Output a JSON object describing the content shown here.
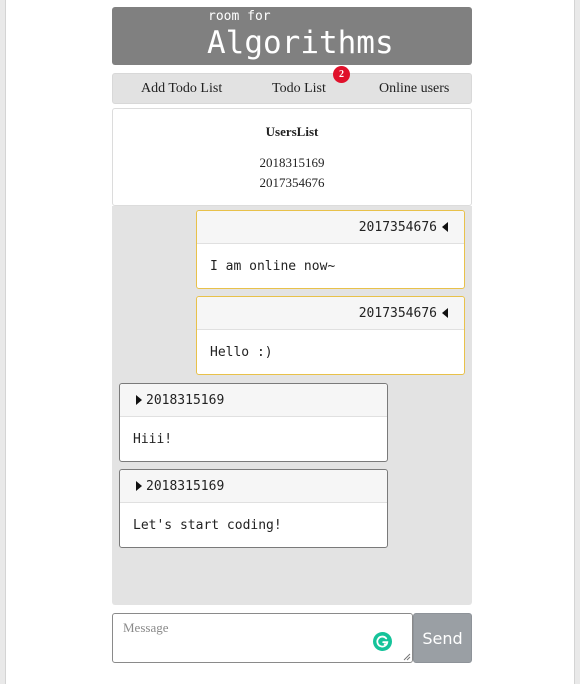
{
  "header": {
    "subtitle": "room for",
    "title": "Algorithms"
  },
  "nav": {
    "items": [
      {
        "label": "Add Todo List"
      },
      {
        "label": "Todo List"
      },
      {
        "label": "Online users"
      }
    ],
    "badge_count": "2"
  },
  "users": {
    "heading": "UsersList",
    "list": [
      "2018315169",
      "2017354676"
    ]
  },
  "messages": [
    {
      "sender": "2017354676",
      "text": "I am online now~",
      "side": "mine"
    },
    {
      "sender": "2017354676",
      "text": "Hello :)",
      "side": "mine"
    },
    {
      "sender": "2018315169",
      "text": "Hiii!",
      "side": "other"
    },
    {
      "sender": "2018315169",
      "text": "Let's start coding!",
      "side": "other"
    }
  ],
  "composer": {
    "placeholder": "Message",
    "value": "",
    "send_label": "Send"
  },
  "colors": {
    "header_bg": "#808080",
    "badge": "#e0112b",
    "mine_border": "#e8c14a",
    "send_bg": "#9a9fa4",
    "grammarly": "#15c39a"
  }
}
